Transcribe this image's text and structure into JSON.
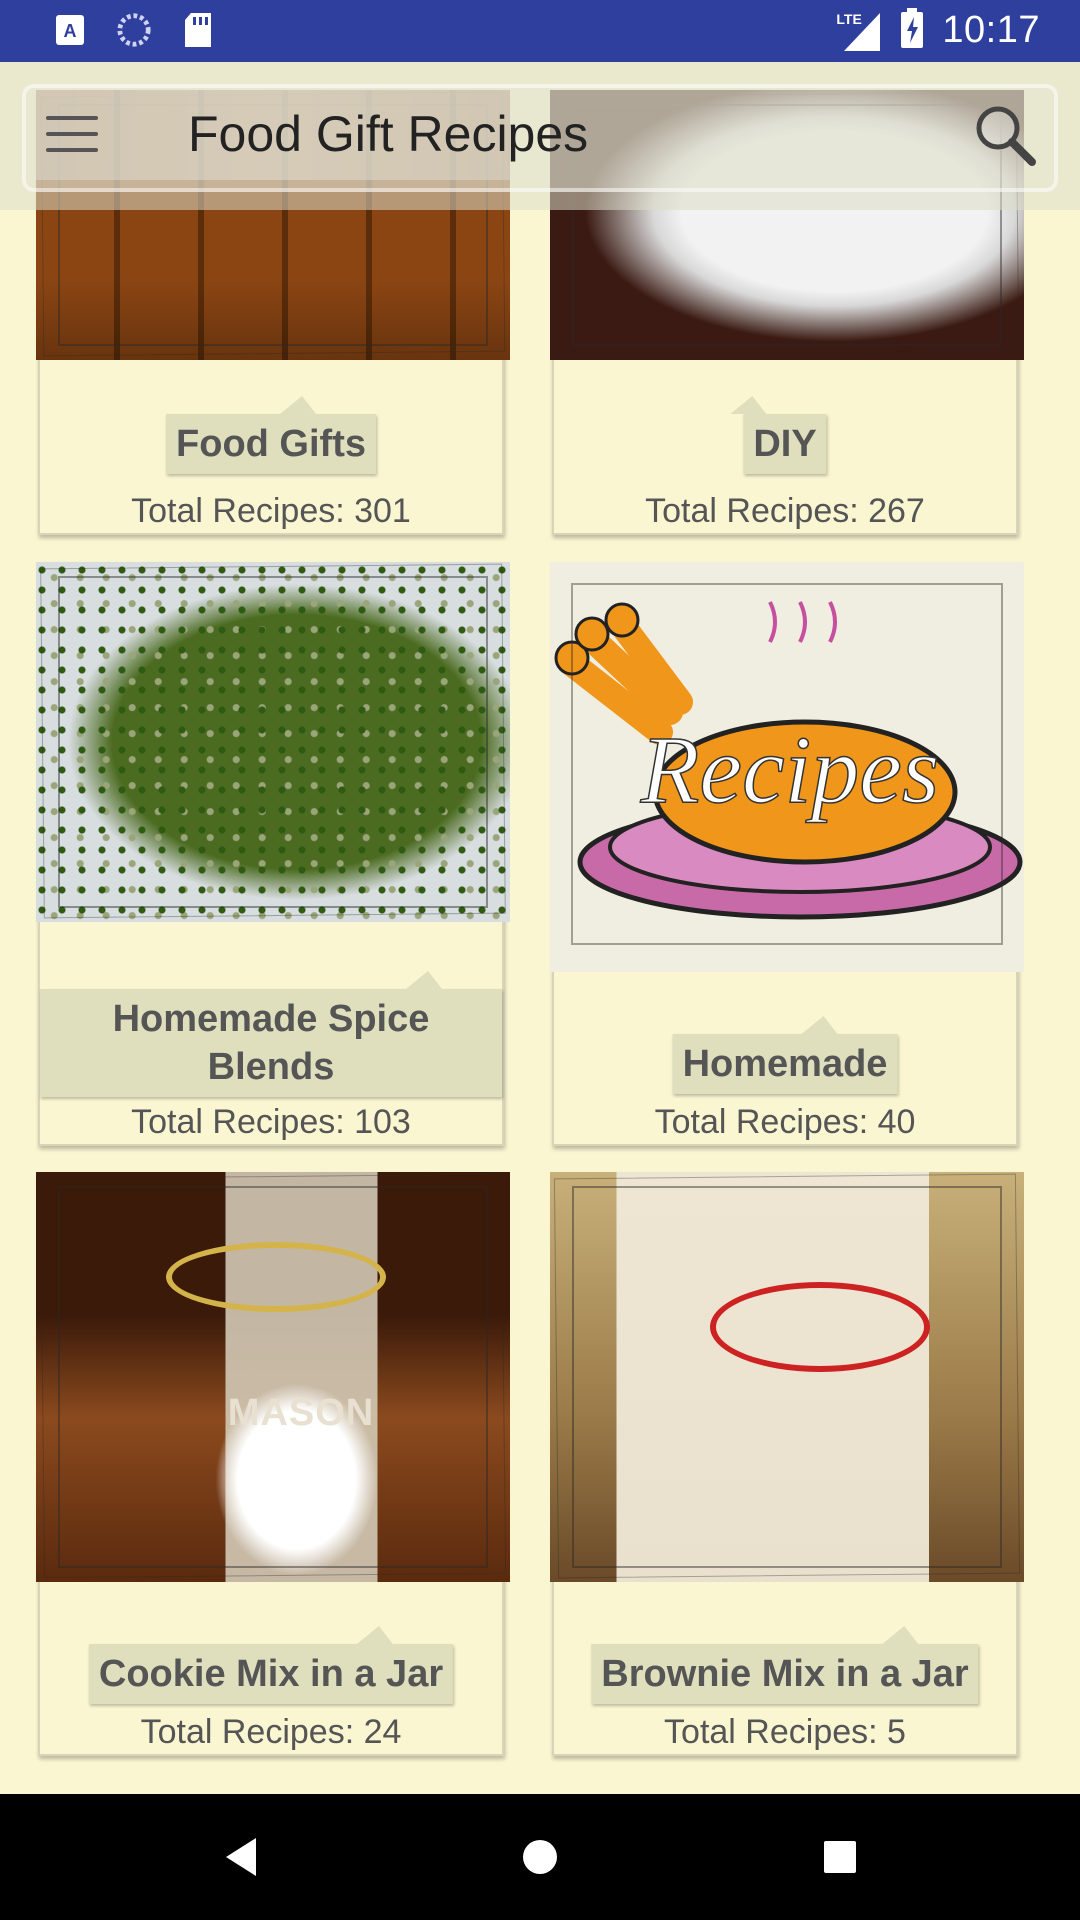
{
  "status_bar": {
    "time": "10:17",
    "network": "LTE",
    "left_icons": [
      "a-icon",
      "sync-icon",
      "sd-card-icon"
    ]
  },
  "app_bar": {
    "title": "Food Gift Recipes",
    "menu_icon": "hamburger-menu-icon",
    "search_icon": "search-icon"
  },
  "categories": [
    {
      "name": "Food Gifts",
      "count": "Total Recipes: 301",
      "image": "bread"
    },
    {
      "name": "DIY",
      "count": "Total Recipes: 267",
      "image": "teapot"
    },
    {
      "name": "Homemade Spice Blends",
      "count": "Total Recipes: 103",
      "image": "spice"
    },
    {
      "name": "Homemade",
      "count": "Total Recipes: 40",
      "image": "recipes-illustration"
    },
    {
      "name": "Cookie Mix in a Jar",
      "count": "Total Recipes: 24",
      "image": "jar"
    },
    {
      "name": "Brownie Mix in a Jar",
      "count": "Total Recipes: 5",
      "image": "jar-ribbon"
    }
  ],
  "recipes_illustration_text": "Recipes",
  "jar_label_text": "MASON",
  "nav_bar": {
    "back_icon": "back-triangle-icon",
    "home_icon": "home-circle-icon",
    "recents_icon": "recents-square-icon"
  },
  "colors": {
    "status_bar": "#2f3f9e",
    "background": "#faf6d2",
    "tag": "#dfdfbd",
    "text": "#555555"
  }
}
